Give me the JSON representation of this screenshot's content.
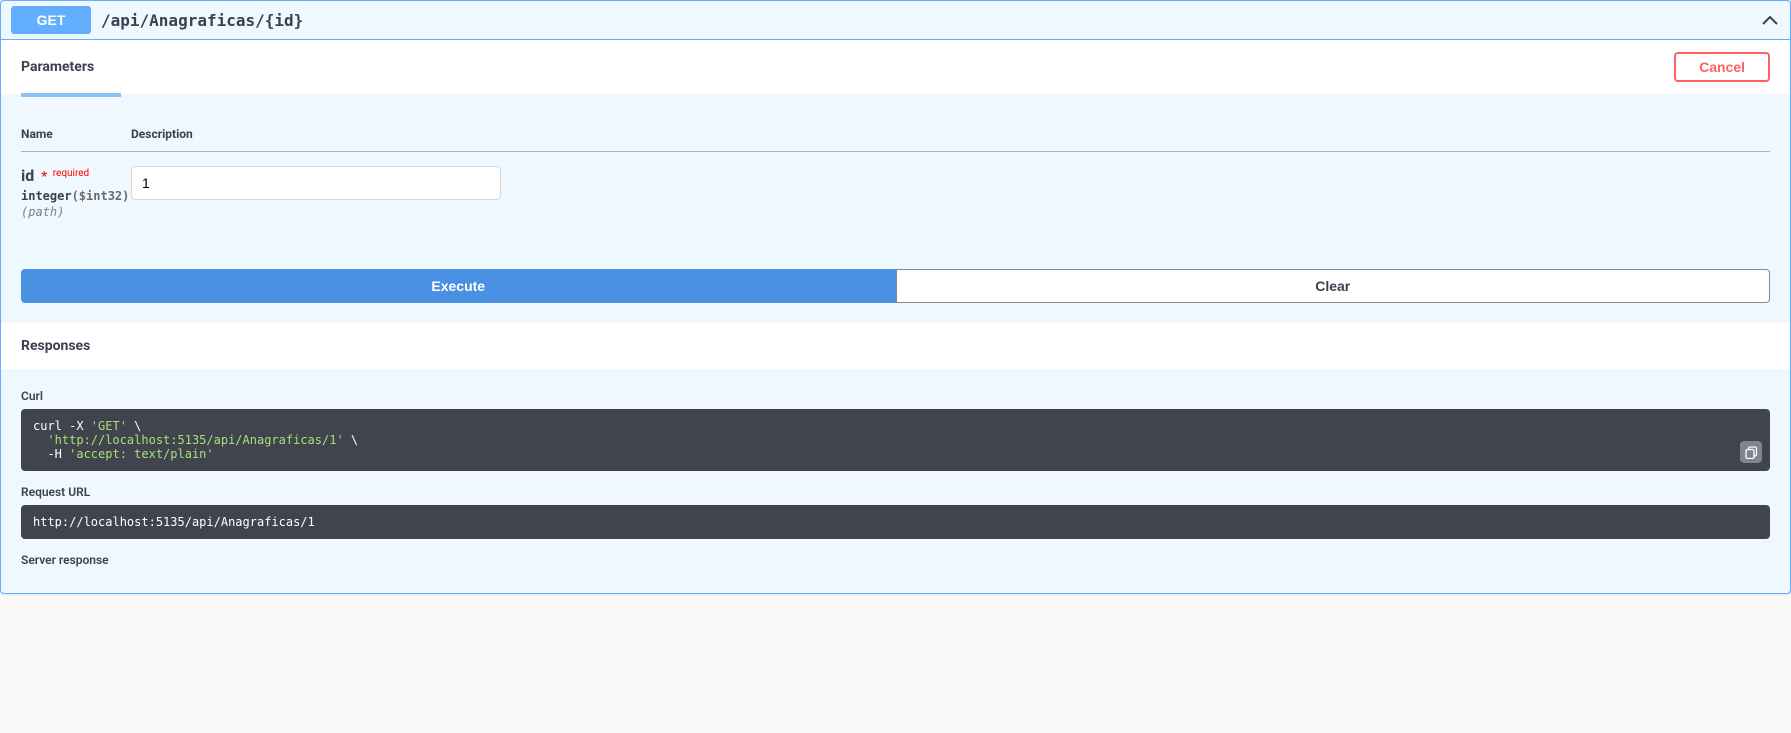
{
  "summary": {
    "method": "GET",
    "path": "/api/Anagraficas/{id}"
  },
  "parameters": {
    "title": "Parameters",
    "cancel_label": "Cancel",
    "headers": {
      "name": "Name",
      "description": "Description"
    },
    "rows": [
      {
        "name": "id",
        "required_label": "required",
        "type_prefix": "integer",
        "type_format": "($int32)",
        "in": "(path)",
        "value": "1"
      }
    ],
    "execute_label": "Execute",
    "clear_label": "Clear"
  },
  "responses": {
    "title": "Responses",
    "curl_label": "Curl",
    "curl_line1_a": "curl -X ",
    "curl_line1_b": "'GET'",
    "curl_line1_c": " \\",
    "curl_line2_a": "  ",
    "curl_line2_b": "'http://localhost:5135/api/Anagraficas/1'",
    "curl_line2_c": " \\",
    "curl_line3_a": "  -H ",
    "curl_line3_b": "'accept: text/plain'",
    "request_url_label": "Request URL",
    "request_url": "http://localhost:5135/api/Anagraficas/1",
    "server_response_label": "Server response"
  }
}
